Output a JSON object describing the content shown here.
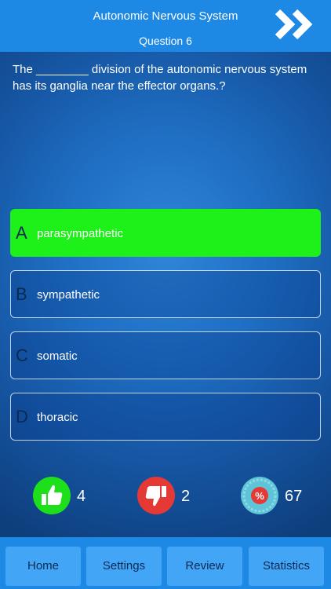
{
  "header": {
    "title": "Autonomic Nervous System",
    "subtitle": "Question 6",
    "next_icon": "double-chevron-right-icon"
  },
  "question": {
    "text": "The ________ division of the autonomic nervous system has its ganglia near the effector organs.?"
  },
  "answers": [
    {
      "letter": "A",
      "text": "parasympathetic",
      "state": "correct",
      "color": "#1ef01a"
    },
    {
      "letter": "B",
      "text": "sympathetic",
      "state": "default"
    },
    {
      "letter": "C",
      "text": "somatic",
      "state": "default"
    },
    {
      "letter": "D",
      "text": "thoracic",
      "state": "default"
    }
  ],
  "stats": {
    "correct": {
      "icon": "thumbs-up-icon",
      "value": "4",
      "color": "#1ee01a"
    },
    "wrong": {
      "icon": "thumbs-down-icon",
      "value": "2",
      "color": "#e53935"
    },
    "percent": {
      "icon": "percent-badge-icon",
      "value": "67",
      "color": "#5ec4d8"
    }
  },
  "nav": {
    "home": "Home",
    "settings": "Settings",
    "review": "Review",
    "statistics": "Statistics"
  },
  "colors": {
    "header_bar": "#1e88e5",
    "nav_button": "#42a5f5",
    "nav_text": "#0b2a52"
  }
}
